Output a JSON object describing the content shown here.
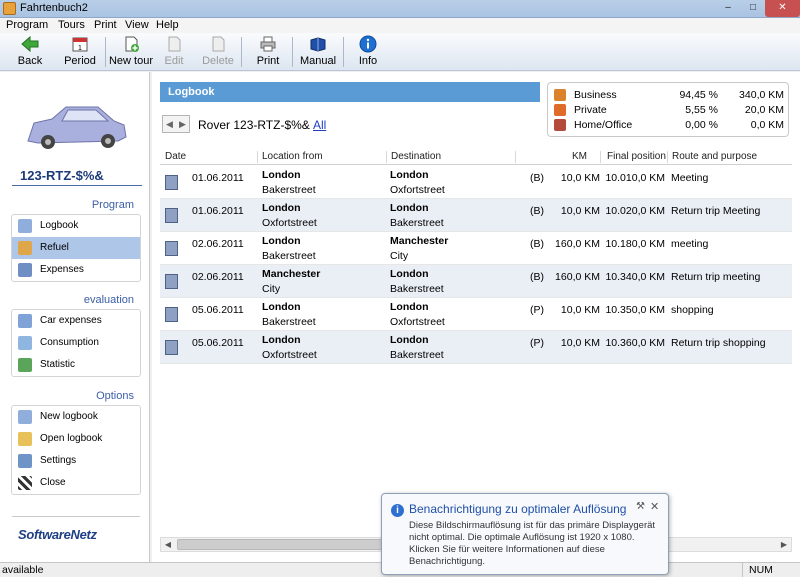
{
  "window": {
    "title": "Fahrtenbuch2"
  },
  "menu": [
    "Program",
    "Tours",
    "Print",
    "View",
    "Help"
  ],
  "toolbar": {
    "back": "Back",
    "period": "Period",
    "new_tour": "New tour",
    "edit": "Edit",
    "delete": "Delete",
    "print": "Print",
    "manual": "Manual",
    "info": "Info"
  },
  "sidebar": {
    "vehicle_title": "123-RTZ-$%&",
    "sections": {
      "program": "Program",
      "evaluation": "evaluation",
      "options": "Options"
    },
    "program_items": [
      {
        "label": "Logbook",
        "icon": "book-icon"
      },
      {
        "label": "Refuel",
        "icon": "fuel-icon"
      },
      {
        "label": "Expenses",
        "icon": "money-icon"
      }
    ],
    "evaluation_items": [
      {
        "label": "Car expenses",
        "icon": "calculator-icon"
      },
      {
        "label": "Consumption",
        "icon": "bucket-icon"
      },
      {
        "label": "Statistic",
        "icon": "chart-icon"
      }
    ],
    "options_items": [
      {
        "label": "New logbook",
        "icon": "new-book-icon"
      },
      {
        "label": "Open logbook",
        "icon": "folder-icon"
      },
      {
        "label": "Settings",
        "icon": "settings-icon"
      },
      {
        "label": "Close",
        "icon": "finish-flag-icon"
      }
    ],
    "logo": "SoftwareNetz"
  },
  "main": {
    "header": "Logbook",
    "vehicle_name": "Rover 123-RTZ-$%&",
    "all_link": "All",
    "summary": [
      {
        "label": "Business",
        "percent": "94,45 %",
        "km": "340,0 KM",
        "color": "#d9822b"
      },
      {
        "label": "Private",
        "percent": "5,55 %",
        "km": "20,0 KM",
        "color": "#e06a2a"
      },
      {
        "label": "Home/Office",
        "percent": "0,00 %",
        "km": "0,0 KM",
        "color": "#b44a3a"
      }
    ],
    "columns": {
      "date": "Date",
      "from": "Location from",
      "destination": "Destination",
      "km": "KM",
      "final_position": "Final position",
      "purpose": "Route and purpose"
    },
    "rows": [
      {
        "date": "01.06.2011",
        "from_city": "London",
        "from_street": "Bakerstreet",
        "to_city": "London",
        "to_street": "Oxfortstreet",
        "flag": "(B)",
        "km": "10,0 KM",
        "final": "10.010,0 KM",
        "purpose": "Meeting"
      },
      {
        "date": "01.06.2011",
        "from_city": "London",
        "from_street": "Oxfortstreet",
        "to_city": "London",
        "to_street": "Bakerstreet",
        "flag": "(B)",
        "km": "10,0 KM",
        "final": "10.020,0 KM",
        "purpose": "Return trip Meeting"
      },
      {
        "date": "02.06.2011",
        "from_city": "London",
        "from_street": "Bakerstreet",
        "to_city": "Manchester",
        "to_street": "City",
        "flag": "(B)",
        "km": "160,0 KM",
        "final": "10.180,0 KM",
        "purpose": "meeting"
      },
      {
        "date": "02.06.2011",
        "from_city": "Manchester",
        "from_street": "City",
        "to_city": "London",
        "to_street": "Bakerstreet",
        "flag": "(B)",
        "km": "160,0 KM",
        "final": "10.340,0 KM",
        "purpose": "Return trip meeting"
      },
      {
        "date": "05.06.2011",
        "from_city": "London",
        "from_street": "Bakerstreet",
        "to_city": "London",
        "to_street": "Oxfortstreet",
        "flag": "(P)",
        "km": "10,0 KM",
        "final": "10.350,0 KM",
        "purpose": "shopping"
      },
      {
        "date": "05.06.2011",
        "from_city": "London",
        "from_street": "Oxfortstreet",
        "to_city": "London",
        "to_street": "Bakerstreet",
        "flag": "(P)",
        "km": "10,0 KM",
        "final": "10.360,0 KM",
        "purpose": "Return trip shopping"
      }
    ]
  },
  "statusbar": {
    "status": "available",
    "num": "NUM"
  },
  "notification": {
    "title": "Benachrichtigung zu optimaler Auflösung",
    "body": "Diese Bildschirmauflösung ist für das primäre Displaygerät nicht optimal. Die optimale Auflösung ist 1920 x 1080. Klicken Sie für weitere Informationen auf diese Benachrichtigung."
  }
}
